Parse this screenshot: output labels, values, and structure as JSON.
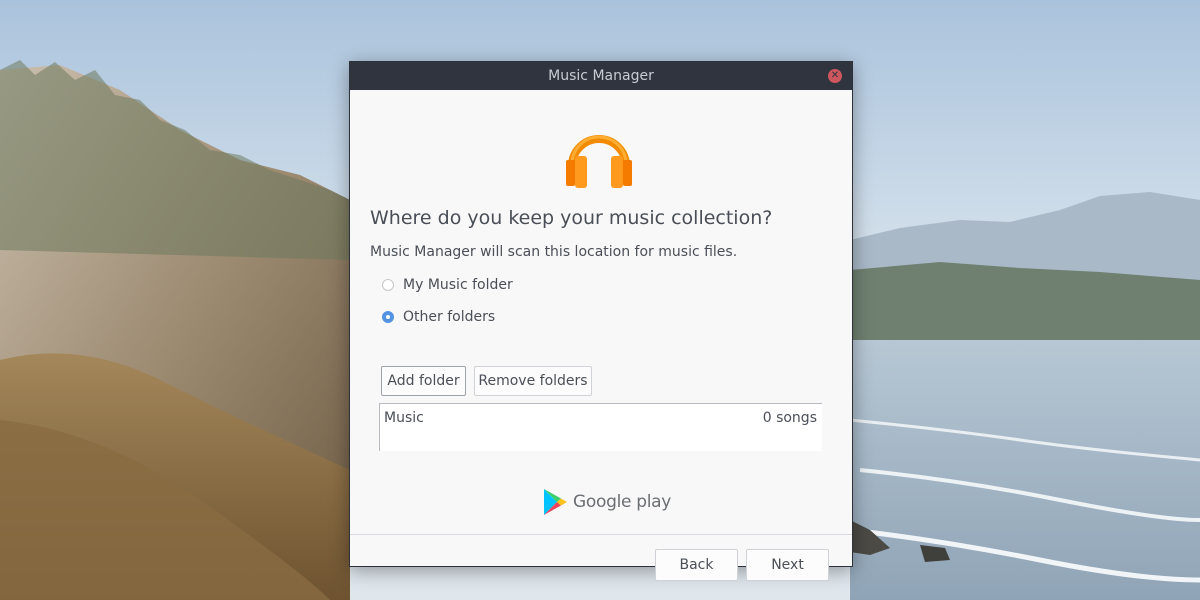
{
  "window": {
    "title": "Music Manager"
  },
  "dialog": {
    "heading": "Where do you keep your music collection?",
    "description": "Music Manager will scan this location for music files.",
    "options": [
      {
        "label": "My Music folder",
        "selected": false
      },
      {
        "label": "Other folders",
        "selected": true
      }
    ],
    "add_folder_label": "Add folder",
    "remove_folders_label": "Remove folders",
    "folders": [
      {
        "name": "Music",
        "count": "0 songs"
      }
    ],
    "brand_label": "Google play",
    "back_label": "Back",
    "next_label": "Next"
  },
  "icons": {
    "close": "close-icon",
    "headphones": "headphones-icon",
    "play_logo": "google-play-icon"
  },
  "colors": {
    "accent": "#5294e2",
    "titlebar": "#2f343f",
    "headphones_orange": "#ff8a00"
  }
}
